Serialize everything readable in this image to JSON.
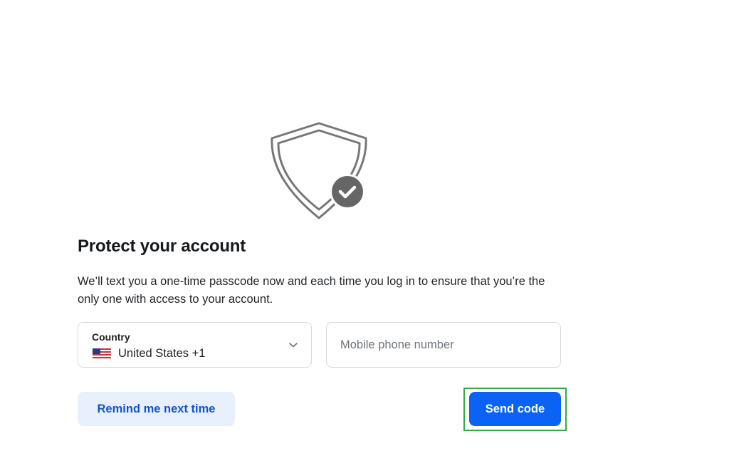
{
  "hero": {
    "icon": "shield-check-icon"
  },
  "title": "Protect your account",
  "description": "We’ll text you a one-time passcode now and each time you log in to ensure that you’re the only one with access to your account.",
  "country": {
    "label": "Country",
    "value": "United States +1",
    "flag_icon": "us-flag-icon",
    "dropdown_icon": "chevron-down-icon"
  },
  "phone": {
    "placeholder": "Mobile phone number",
    "value": ""
  },
  "actions": {
    "remind_label": "Remind me next time",
    "send_label": "Send code"
  },
  "colors": {
    "primary": "#0b63f6",
    "secondary_bg": "#e8f0fd",
    "secondary_text": "#1452cc",
    "highlight": "#35a94b"
  }
}
